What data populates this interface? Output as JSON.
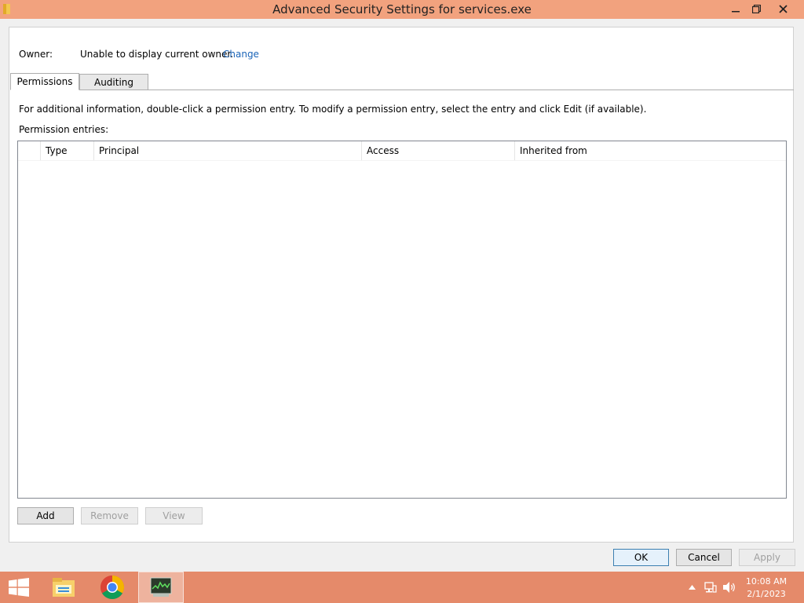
{
  "window": {
    "title": "Advanced Security Settings for services.exe"
  },
  "owner": {
    "label": "Owner:",
    "value": "Unable to display current owner.",
    "change_link": "Change"
  },
  "tabs": [
    {
      "label": "Permissions",
      "selected": true
    },
    {
      "label": "Auditing",
      "selected": false
    }
  ],
  "permissions": {
    "info": "For additional information, double-click a permission entry. To modify a permission entry, select the entry and click Edit (if available).",
    "entries_label": "Permission entries:",
    "columns": [
      "Type",
      "Principal",
      "Access",
      "Inherited from"
    ],
    "rows": []
  },
  "entry_buttons": {
    "add": "Add",
    "remove": "Remove",
    "view": "View"
  },
  "dialog_buttons": {
    "ok": "OK",
    "cancel": "Cancel",
    "apply": "Apply"
  },
  "taskbar": {
    "apps": [
      {
        "icon": "file-explorer-icon"
      },
      {
        "icon": "chrome-icon"
      },
      {
        "icon": "task-manager-icon",
        "active": true
      }
    ],
    "clock": {
      "time": "10:08 AM",
      "date": "2/1/2023"
    }
  },
  "colors": {
    "titlebar": "#f2a27e",
    "taskbar": "#e58a6a",
    "link": "#1a64b8"
  }
}
